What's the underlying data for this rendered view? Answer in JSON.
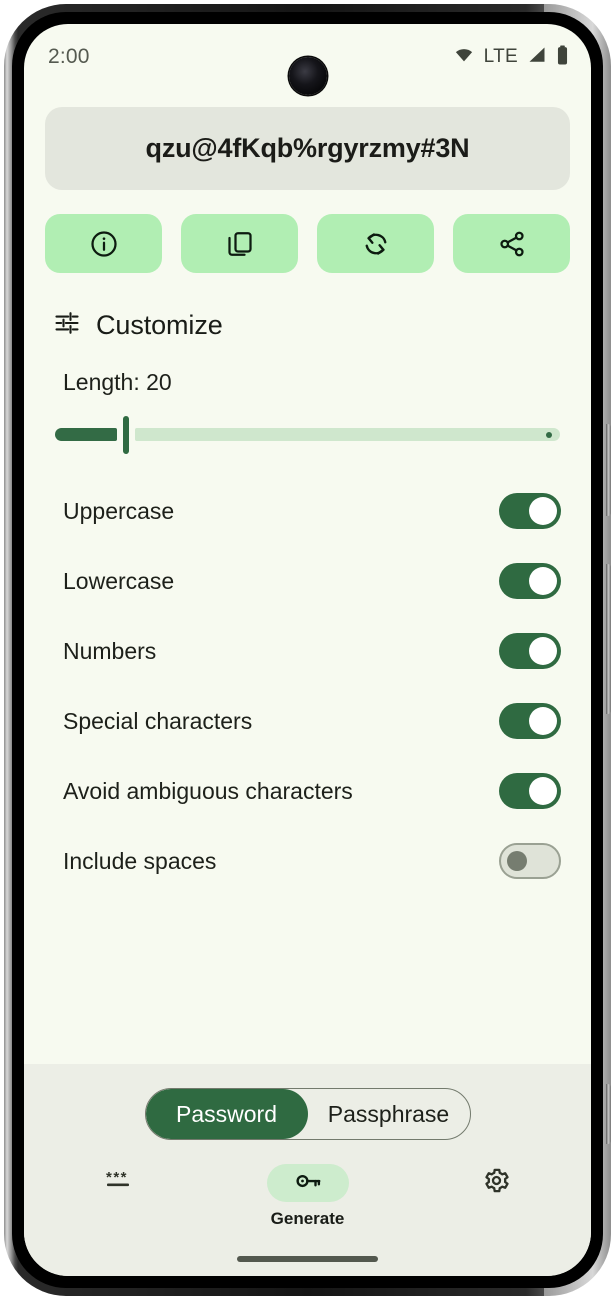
{
  "status_bar": {
    "time": "2:00",
    "network_label": "LTE",
    "icons": [
      "wifi-icon",
      "signal-icon",
      "battery-icon"
    ]
  },
  "password": {
    "value": "qzu@4fKqb%rgyrzmy#3N"
  },
  "actions": [
    {
      "name": "info-button",
      "icon": "info-icon"
    },
    {
      "name": "copy-button",
      "icon": "copy-icon"
    },
    {
      "name": "regenerate-button",
      "icon": "refresh-icon"
    },
    {
      "name": "share-button",
      "icon": "share-icon"
    }
  ],
  "customize": {
    "title": "Customize",
    "icon": "tune-icon",
    "length_label": "Length: 20",
    "length_value": 20,
    "slider": {
      "min": 4,
      "max": 128,
      "value": 20,
      "fill_percent": 12
    }
  },
  "options": [
    {
      "label": "Uppercase",
      "enabled": true
    },
    {
      "label": "Lowercase",
      "enabled": true
    },
    {
      "label": "Numbers",
      "enabled": true
    },
    {
      "label": "Special characters",
      "enabled": true
    },
    {
      "label": "Avoid ambiguous characters",
      "enabled": true
    },
    {
      "label": "Include spaces",
      "enabled": false
    }
  ],
  "mode_switch": {
    "options": [
      "Password",
      "Passphrase"
    ],
    "selected": "Password"
  },
  "bottom_nav": {
    "items": [
      {
        "label": "",
        "icon": "password-asterisks-icon",
        "active": false
      },
      {
        "label": "Generate",
        "icon": "key-icon",
        "active": true
      },
      {
        "label": "",
        "icon": "gear-icon",
        "active": false
      }
    ]
  },
  "colors": {
    "accent_green": "#2f6a41",
    "light_green": "#b1eeb3",
    "nav_pill_green": "#cdeccd",
    "screen_bg": "#f7faf0",
    "bottom_bg": "#eceee6",
    "field_bg": "#e3e6dd"
  }
}
